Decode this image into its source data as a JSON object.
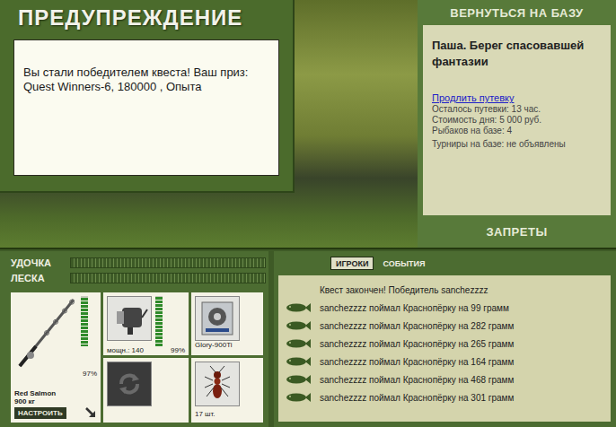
{
  "warning": {
    "title": "ПРЕДУПРЕЖДЕНИЕ",
    "message": "Вы стали победителем квеста! Ваш приз: Quest Winners-6, 180000 , Опыта"
  },
  "base": {
    "header": "ВЕРНУТЬСЯ НА БАЗУ",
    "name": "Паша. Берег спасовавшей фантазии",
    "extend_link": "Продлить путевку",
    "info": [
      "Осталось путевки: 13 час.",
      "Стоимость дня: 5 000 руб.",
      "Рыбаков на базе: 4",
      "Турниры на базе: не объявлены"
    ],
    "footer": "ЗАПРЕТЫ"
  },
  "meters": [
    {
      "label": "УДОЧКА",
      "level": 0
    },
    {
      "label": "ЛЕСКА",
      "level": 0
    }
  ],
  "rod": {
    "name": "Red Salmon",
    "capacity": "900 кг",
    "level": 0.97,
    "reading": "97%",
    "button": "НАСТРОИТЬ"
  },
  "reel": {
    "power": "мощн.: 140",
    "level": 0.99,
    "reading": "99%"
  },
  "line": {
    "name": "Glory-900Ti"
  },
  "bait": {
    "count": "17 шт."
  },
  "tabs": [
    {
      "label": "ИГРОКИ",
      "selected": true
    },
    {
      "label": "СОБЫТИЯ",
      "selected": false
    }
  ],
  "events": [
    {
      "text": "Квест закончен! Победитель sanchezzzz",
      "kind": "notice"
    },
    {
      "text": "sanchezzzz поймал Краснопёрку на 99 грамм",
      "kind": "catch"
    },
    {
      "text": "sanchezzzz поймал Краснопёрку на 282 грамм",
      "kind": "catch"
    },
    {
      "text": "sanchezzzz поймал Краснопёрку на 265 грамм",
      "kind": "catch"
    },
    {
      "text": "sanchezzzz поймал Краснопёрку на 164 грамм",
      "kind": "catch"
    },
    {
      "text": "sanchezzzz поймал Краснопёрку на 468 грамм",
      "kind": "catch"
    },
    {
      "text": "sanchezzzz поймал Краснопёрку на 301 грамм",
      "kind": "catch"
    }
  ]
}
